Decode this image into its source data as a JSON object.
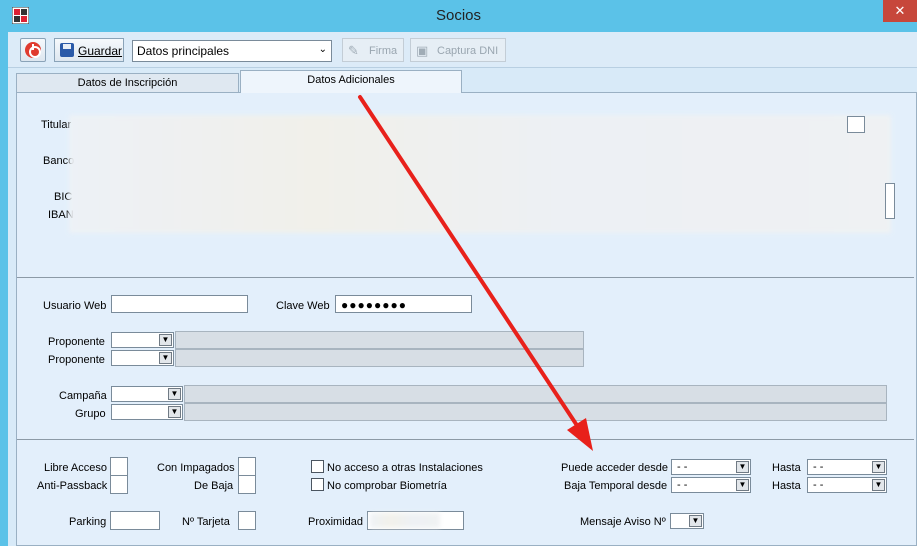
{
  "window": {
    "title": "Socios",
    "close_glyph": "✕"
  },
  "toolbar": {
    "save_label": "Guardar",
    "view_select_value": "Datos principales",
    "firma_label": "Firma",
    "captura_label": "Captura DNI"
  },
  "tabs": [
    {
      "label": "Datos de Inscripción"
    },
    {
      "label": "Datos Adicionales"
    }
  ],
  "bank": {
    "titular_label": "Titular",
    "banco_label": "Banco",
    "bic_label": "BIC",
    "iban_label": "IBAN"
  },
  "web": {
    "usuario_label": "Usuario Web",
    "clave_label": "Clave Web",
    "clave_value": "●●●●●●●●"
  },
  "proponentes": [
    {
      "label": "Proponente"
    },
    {
      "label": "Proponente"
    }
  ],
  "campana_label": "Campaña",
  "grupo_label": "Grupo",
  "access": {
    "libre_acceso": "Libre Acceso",
    "anti_passback": "Anti-Passback",
    "con_impagados": "Con Impagados",
    "de_baja": "De Baja",
    "no_acceso_otras": "No acceso a otras Instalaciones",
    "no_comprobar_biometria": "No comprobar Biometría",
    "puede_acceder_desde": "Puede acceder desde",
    "baja_temporal_desde": "Baja Temporal desde",
    "hasta1": "Hasta",
    "hasta2": "Hasta",
    "date_empty": "-  -",
    "parking": "Parking",
    "num_tarjeta": "Nº Tarjeta",
    "proximidad": "Proximidad",
    "mensaje_aviso": "Mensaje Aviso Nº"
  },
  "colors": {
    "titlebar": "#5bc2e8",
    "close": "#c7473b",
    "annotation_arrow": "#e8211b"
  }
}
